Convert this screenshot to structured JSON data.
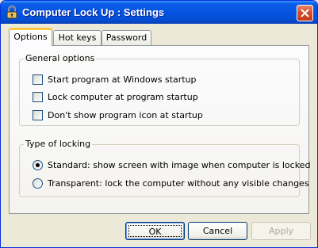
{
  "window": {
    "title": "Computer Lock Up : Settings",
    "colors": {
      "titlebar": "#0554e3",
      "face": "#ece9d8",
      "close": "#c23a17"
    }
  },
  "tabs": [
    {
      "label": "Options",
      "active": true
    },
    {
      "label": "Hot keys",
      "active": false
    },
    {
      "label": "Password",
      "active": false
    }
  ],
  "general_options": {
    "title": "General options",
    "items": [
      {
        "label": "Start program at Windows startup",
        "checked": false
      },
      {
        "label": "Lock computer at program startup",
        "checked": false
      },
      {
        "label": "Don't show program icon at startup",
        "checked": false
      }
    ]
  },
  "locking": {
    "title": "Type of locking",
    "items": [
      {
        "label": "Standard: show screen with image when computer is locked",
        "selected": true
      },
      {
        "label": "Transparent: lock the computer without any visible changes",
        "selected": false
      }
    ]
  },
  "buttons": {
    "ok": "OK",
    "cancel": "Cancel",
    "apply": "Apply"
  }
}
